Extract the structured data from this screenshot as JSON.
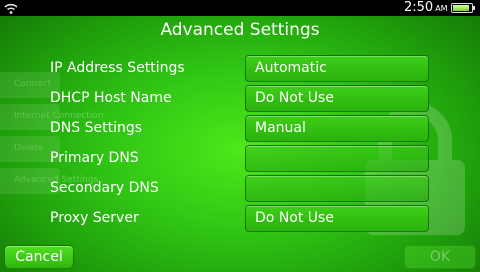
{
  "status_bar": {
    "time": "2:50",
    "ampm": "AM"
  },
  "title": "Advanced Settings",
  "background_menu": [
    "Connect",
    "Internet Connection",
    "Delete",
    "Advanced Settings"
  ],
  "rows": [
    {
      "label": "IP Address Settings",
      "value": "Automatic"
    },
    {
      "label": "DHCP Host Name",
      "value": "Do Not Use"
    },
    {
      "label": "DNS Settings",
      "value": "Manual"
    },
    {
      "label": "Primary DNS",
      "value": ""
    },
    {
      "label": "Secondary DNS",
      "value": ""
    },
    {
      "label": "Proxy Server",
      "value": "Do Not Use"
    }
  ],
  "buttons": {
    "cancel": "Cancel",
    "ok": "OK"
  },
  "colors": {
    "accent_green": "#2fc414",
    "status_bar": "#000000"
  }
}
